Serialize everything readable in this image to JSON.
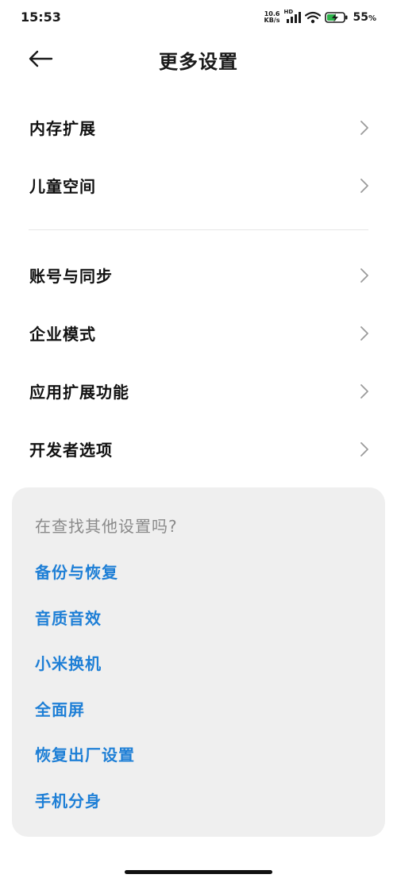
{
  "status_bar": {
    "time": "15:53",
    "net_speed_value": "10.6",
    "net_speed_unit": "KB/s",
    "hd_label": "HD",
    "battery_percent": "55",
    "battery_suffix": "%"
  },
  "header": {
    "title": "更多设置"
  },
  "group1": {
    "items": [
      {
        "label": "内存扩展"
      },
      {
        "label": "儿童空间"
      }
    ]
  },
  "group2": {
    "items": [
      {
        "label": "账号与同步"
      },
      {
        "label": "企业模式"
      },
      {
        "label": "应用扩展功能"
      },
      {
        "label": "开发者选项"
      }
    ]
  },
  "suggest": {
    "title": "在查找其他设置吗?",
    "links": [
      {
        "label": "备份与恢复"
      },
      {
        "label": "音质音效"
      },
      {
        "label": "小米换机"
      },
      {
        "label": "全面屏"
      },
      {
        "label": "恢复出厂设置"
      },
      {
        "label": "手机分身"
      }
    ]
  },
  "colors": {
    "link": "#1e7fd6",
    "card_bg": "#efefef",
    "muted_text": "#8a8a8a",
    "battery_charge": "#2cb34a"
  }
}
